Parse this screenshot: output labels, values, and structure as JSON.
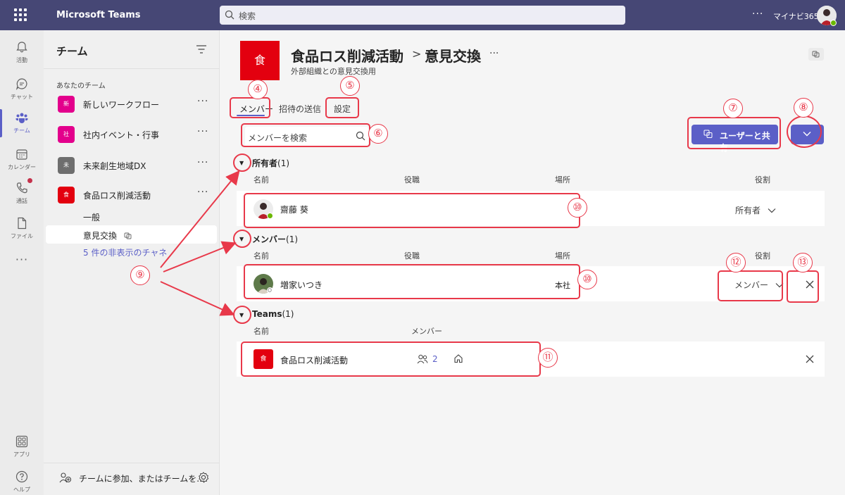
{
  "app": {
    "title": "Microsoft Teams",
    "search_placeholder": "検索",
    "more": "···",
    "org": "マイナビ365"
  },
  "rail": [
    {
      "label": "活動",
      "icon": "bell-icon"
    },
    {
      "label": "チャット",
      "icon": "chat-icon"
    },
    {
      "label": "チーム",
      "icon": "teams-icon"
    },
    {
      "label": "カレンダー",
      "icon": "calendar-icon"
    },
    {
      "label": "通話",
      "icon": "phone-icon"
    },
    {
      "label": "ファイル",
      "icon": "file-icon"
    },
    {
      "label": "アプリ",
      "icon": "apps-icon"
    },
    {
      "label": "ヘルプ",
      "icon": "help-icon"
    }
  ],
  "rail_more": "···",
  "teams_panel": {
    "title": "チーム",
    "section": "あなたのチーム",
    "teams": [
      {
        "tile": "新",
        "name": "新しいワークフロー",
        "color": "#e3008c"
      },
      {
        "tile": "社",
        "name": "社内イベント・行事",
        "color": "#e3008c"
      },
      {
        "tile": "未",
        "name": "未来創生地域DX",
        "color": "#6e6e6e"
      },
      {
        "tile": "食",
        "name": "食品ロス削減活動",
        "color": "#e3000f"
      }
    ],
    "channels": [
      "一般",
      "意見交換"
    ],
    "hidden_channels": "5 件の非表示のチャネル",
    "join": "チームに参加、またはチームを..."
  },
  "header": {
    "tile": "食",
    "team": "食品ロス削減活動",
    "separator": ">",
    "channel": "意見交換",
    "more": "···",
    "subtitle": "外部組織との意見交換用"
  },
  "tabs": [
    "メンバー",
    "招待の送信",
    "設定"
  ],
  "search": {
    "placeholder": "メンバーを検索"
  },
  "share": {
    "label": "ユーザーと共有"
  },
  "groups": {
    "owners": {
      "title": "所有者",
      "count": "(1)"
    },
    "members": {
      "title": "メンバー",
      "count": "(1)"
    },
    "teams": {
      "title": "Teams",
      "count": "(1)"
    }
  },
  "columns": {
    "name": "名前",
    "title": "役職",
    "location": "場所",
    "role": "役割",
    "members": "メンバー"
  },
  "owner_row": {
    "name": "齋藤 葵",
    "role": "所有者"
  },
  "member_row": {
    "name": "増家いつき",
    "location": "本社",
    "role": "メンバー"
  },
  "team_row": {
    "tile": "食",
    "name": "食品ロス削減活動",
    "count": "2"
  },
  "annotations": [
    "④",
    "⑤",
    "⑥",
    "⑦",
    "⑧",
    "⑨",
    "⑩",
    "⑩",
    "⑪",
    "⑫",
    "⑬"
  ],
  "colors": {
    "accent": "#5b5fc7",
    "topbar": "#464775",
    "annotation": "#e8394a",
    "team_tile": "#e3000f"
  }
}
